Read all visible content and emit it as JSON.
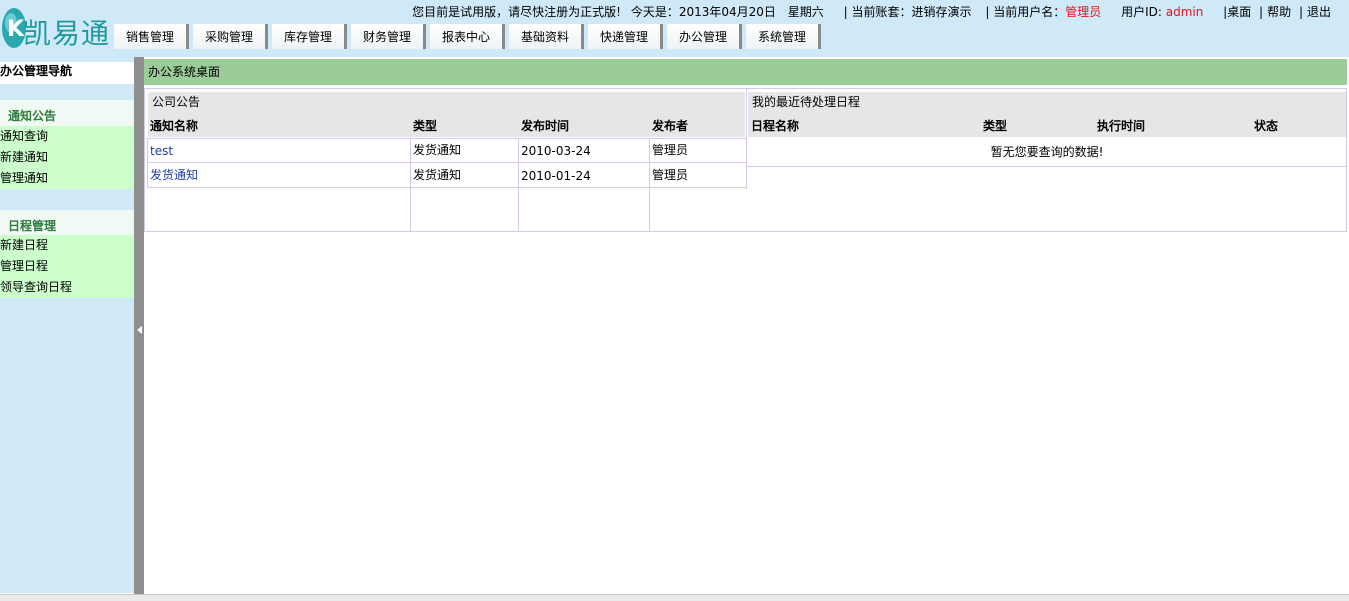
{
  "brand": {
    "logo_letter": "K",
    "name": "凯易通"
  },
  "topbar": {
    "notice": "您目前是试用版，请尽快注册为正式版!",
    "today_label": "今天是：",
    "date": "2013年04月20日",
    "weekday": "星期六",
    "account_label": "当前账套：",
    "account": "进销存演示",
    "user_label": "当前用户名：",
    "user": "管理员",
    "userid_label": "用户ID:",
    "userid": "admin",
    "links": [
      "桌面",
      "帮助",
      "退出"
    ]
  },
  "menu": [
    "销售管理",
    "采购管理",
    "库存管理",
    "财务管理",
    "报表中心",
    "基础资料",
    "快递管理",
    "办公管理",
    "系统管理"
  ],
  "sidebar": {
    "title": "办公管理导航",
    "groups": [
      {
        "title": "通知公告",
        "items": [
          "通知查询",
          "新建通知",
          "管理通知"
        ]
      },
      {
        "title": "日程管理",
        "items": [
          "新建日程",
          "管理日程",
          "领导查询日程"
        ]
      }
    ]
  },
  "main": {
    "title": "办公系统桌面",
    "notices": {
      "title": "公司公告",
      "columns": [
        "通知名称",
        "类型",
        "发布时间",
        "发布者"
      ],
      "rows": [
        {
          "name": "test",
          "type": "发货通知",
          "date": "2010-03-24",
          "publisher": "管理员"
        },
        {
          "name": "发货通知",
          "type": "发货通知",
          "date": "2010-01-24",
          "publisher": "管理员"
        }
      ]
    },
    "schedule": {
      "title": "我的最近待处理日程",
      "columns": [
        "日程名称",
        "类型",
        "执行时间",
        "状态"
      ],
      "empty": "暂无您要查询的数据!"
    }
  },
  "colors": {
    "accent_red": "#e8121e",
    "logo_teal": "#1f9a9f",
    "header_bg": "#cfe9f9",
    "title_green": "#9ccc99",
    "sidebar_item_bg": "#ccffcc",
    "link_blue": "#1f3fa8"
  },
  "icons": [
    "logo-k-icon",
    "collapse-arrow-icon"
  ]
}
